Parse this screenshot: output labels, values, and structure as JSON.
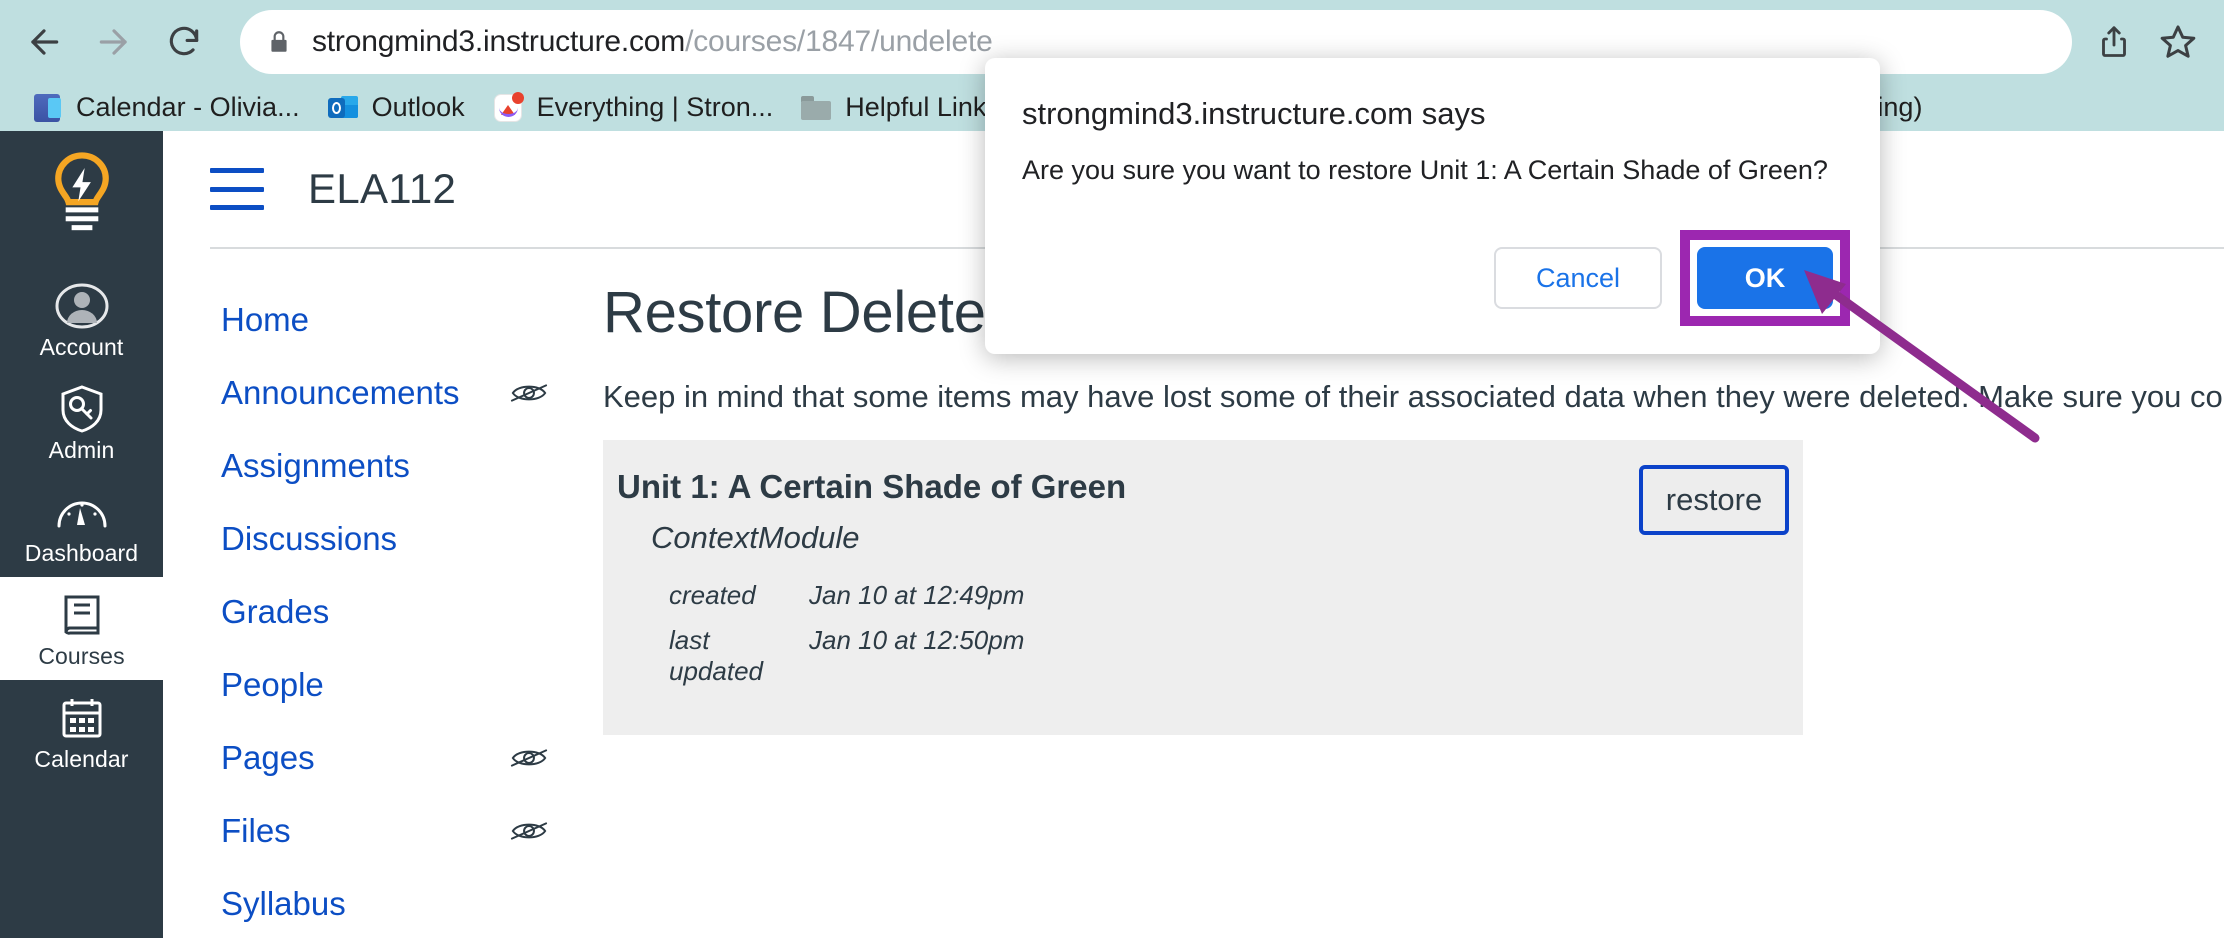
{
  "browser": {
    "back_icon": "arrow-left-icon",
    "forward_icon": "arrow-right-icon",
    "reload_icon": "reload-icon",
    "lock_icon": "lock-icon",
    "share_icon": "share-icon",
    "star_icon": "star-icon",
    "url": {
      "host": "strongmind3.instructure.com",
      "path": "/courses/1847/undelete",
      "full": "strongmind3.instructure.com/courses/1847/undelete"
    },
    "bookmarks": [
      {
        "label": "Calendar - Olivia...",
        "icon": "teams-calendar-icon"
      },
      {
        "label": "Outlook",
        "icon": "outlook-icon"
      },
      {
        "label": "Everything | Stron...",
        "icon": "canvas-icon"
      },
      {
        "label": "Helpful Links",
        "icon": "folder-icon"
      },
      {
        "label": "ndesk (Ticketing)",
        "icon": "none"
      }
    ]
  },
  "global_nav": {
    "logo": "canvas-lightbulb-logo",
    "items": [
      {
        "label": "Account",
        "icon": "user-avatar-icon",
        "active": false
      },
      {
        "label": "Admin",
        "icon": "shield-key-icon",
        "active": false
      },
      {
        "label": "Dashboard",
        "icon": "gauge-icon",
        "active": false
      },
      {
        "label": "Courses",
        "icon": "book-icon",
        "active": true
      },
      {
        "label": "Calendar",
        "icon": "calendar-icon",
        "active": false
      }
    ]
  },
  "course_header": {
    "menu_toggle_icon": "hamburger-menu-icon",
    "title": "ELA112"
  },
  "course_nav": {
    "items": [
      {
        "label": "Home",
        "hidden_icon": false
      },
      {
        "label": "Announcements",
        "hidden_icon": true
      },
      {
        "label": "Assignments",
        "hidden_icon": false
      },
      {
        "label": "Discussions",
        "hidden_icon": false
      },
      {
        "label": "Grades",
        "hidden_icon": false
      },
      {
        "label": "People",
        "hidden_icon": false
      },
      {
        "label": "Pages",
        "hidden_icon": true
      },
      {
        "label": "Files",
        "hidden_icon": true
      },
      {
        "label": "Syllabus",
        "hidden_icon": false
      }
    ]
  },
  "main": {
    "page_title": "Restore Deleted Items",
    "description": "Keep in mind that some items may have lost some of their associated data when they were deleted. Make sure you co",
    "restore_items": [
      {
        "title": "Unit 1: A Certain Shade of Green",
        "type": "ContextModule",
        "created_label": "created",
        "created_value": "Jan 10 at 12:49pm",
        "updated_label": "last updated",
        "updated_value": "Jan 10 at 12:50pm",
        "button_label": "restore"
      }
    ]
  },
  "dialog": {
    "title": "strongmind3.instructure.com says",
    "message": "Are you sure you want to restore Unit 1: A Certain Shade of Green?",
    "cancel_label": "Cancel",
    "ok_label": "OK"
  },
  "annotation": {
    "highlight_color": "#9c27b0",
    "arrow_color": "#8e2c8e",
    "target": "ok-button"
  },
  "colors": {
    "chrome_bg": "#bfdfe0",
    "canvas_nav_bg": "#2d3b45",
    "link_blue": "#0c4ec4",
    "dialog_blue": "#1a73e8",
    "card_bg": "#eeeeee"
  }
}
